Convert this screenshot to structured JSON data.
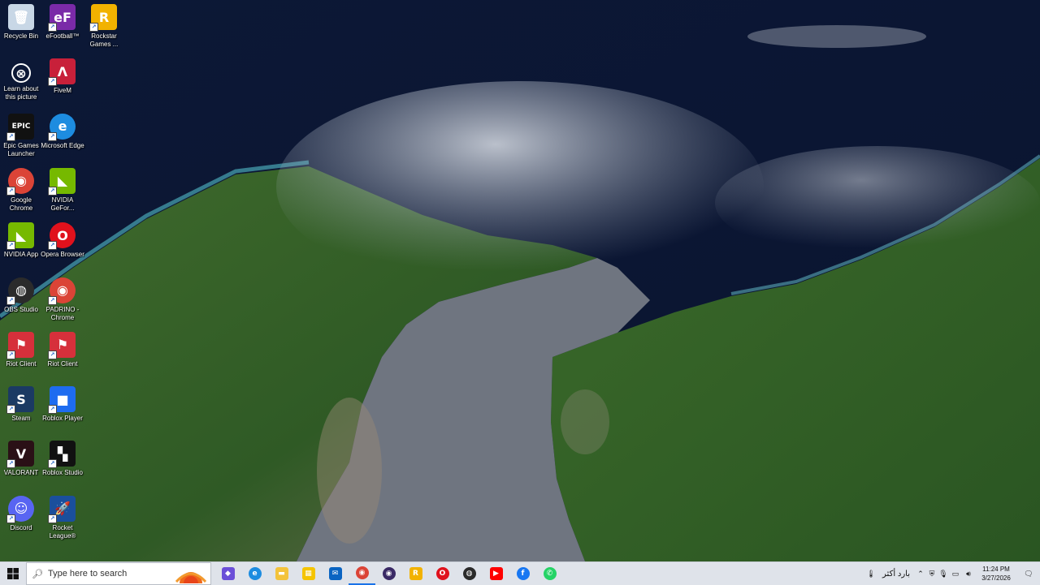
{
  "desktop_icons": [
    {
      "label": "Recycle Bin",
      "icon": "recycle-bin-icon",
      "color": "#c8d7e6"
    },
    {
      "label": "eFootball™",
      "icon": "efootball-icon",
      "color": "#7a2aa8"
    },
    {
      "label": "Rockstar Games ...",
      "icon": "rockstar-icon",
      "color": "#f2b200"
    },
    {
      "label": "Learn about this picture",
      "icon": "camera-info-icon",
      "color": "transparent"
    },
    {
      "label": "FiveM",
      "icon": "fivem-icon",
      "color": "#c8203a"
    },
    {
      "label": "Epic Games Launcher",
      "icon": "epic-games-icon",
      "color": "#111111"
    },
    {
      "label": "Microsoft Edge",
      "icon": "edge-icon",
      "color": "#1d8ce0"
    },
    {
      "label": "Google Chrome",
      "icon": "chrome-icon",
      "color": "#db4437"
    },
    {
      "label": "NVIDIA GeFor...",
      "icon": "nvidia-geforce-icon",
      "color": "#76b900"
    },
    {
      "label": "NVIDIA App",
      "icon": "nvidia-app-icon",
      "color": "#76b900"
    },
    {
      "label": "Opera Browser",
      "icon": "opera-icon",
      "color": "#e0111c"
    },
    {
      "label": "OBS Studio",
      "icon": "obs-icon",
      "color": "#2b2b2b"
    },
    {
      "label": "PADRINO - Chrome",
      "icon": "chrome-profile-icon",
      "color": "#db4437"
    },
    {
      "label": "Riot Client",
      "icon": "riot-client-icon",
      "color": "#d6303b"
    },
    {
      "label": "Riot Client",
      "icon": "riot-client-icon",
      "color": "#d6303b"
    },
    {
      "label": "Steam",
      "icon": "steam-icon",
      "color": "#1b3a63"
    },
    {
      "label": "Roblox Player",
      "icon": "roblox-player-icon",
      "color": "#1e6cf0"
    },
    {
      "label": "VALORANT",
      "icon": "valorant-icon",
      "color": "#2a1016"
    },
    {
      "label": "Roblox Studio",
      "icon": "roblox-studio-icon",
      "color": "#111111"
    },
    {
      "label": "Discord",
      "icon": "discord-icon",
      "color": "#5865f2"
    },
    {
      "label": "Rocket League®",
      "icon": "rocket-league-icon",
      "color": "#1a4f9c"
    }
  ],
  "icon_glyphs": {
    "efootball": "eF",
    "rockstar": "R",
    "fivem": "Λ",
    "epic": "EPIC",
    "nvidia": "◣",
    "opera": "O",
    "riot": "⚑",
    "steam": "S",
    "roblox": "■",
    "valorant": "V",
    "studio": "▚",
    "discord": "☺",
    "rocket": "🚀"
  },
  "taskbar": {
    "search_placeholder": "Type here to search",
    "apps": [
      {
        "name": "copilot",
        "icon": "copilot-icon",
        "color": "#6b4fd8",
        "glyph": "◆"
      },
      {
        "name": "edge",
        "icon": "edge-icon",
        "color": "#1d8ce0",
        "glyph": "e"
      },
      {
        "name": "file-explorer",
        "icon": "folder-icon",
        "color": "#f3c33b",
        "glyph": "▬"
      },
      {
        "name": "store",
        "icon": "store-icon",
        "color": "#f5c400",
        "glyph": "▦"
      },
      {
        "name": "mail",
        "icon": "mail-icon",
        "color": "#0a64c2",
        "glyph": "✉"
      },
      {
        "name": "chrome",
        "icon": "chrome-icon",
        "color": "#db4437",
        "glyph": "◉",
        "active": true
      },
      {
        "name": "chrome-profile",
        "icon": "chrome-profile-icon",
        "color": "#3a2a66",
        "glyph": "◉"
      },
      {
        "name": "rockstar",
        "icon": "rockstar-icon",
        "color": "#f2b200",
        "glyph": "R"
      },
      {
        "name": "opera",
        "icon": "opera-icon",
        "color": "#e0111c",
        "glyph": "O"
      },
      {
        "name": "obs",
        "icon": "obs-icon",
        "color": "#2b2b2b",
        "glyph": "◍"
      },
      {
        "name": "youtube",
        "icon": "youtube-icon",
        "color": "#ff0000",
        "glyph": "▶"
      },
      {
        "name": "facebook",
        "icon": "facebook-icon",
        "color": "#1877f2",
        "glyph": "f"
      },
      {
        "name": "whatsapp",
        "icon": "whatsapp-icon",
        "color": "#25d366",
        "glyph": "✆"
      }
    ],
    "weather_text": "بارد أكثر",
    "time": "11:24 PM",
    "date": "3/27/2026"
  }
}
